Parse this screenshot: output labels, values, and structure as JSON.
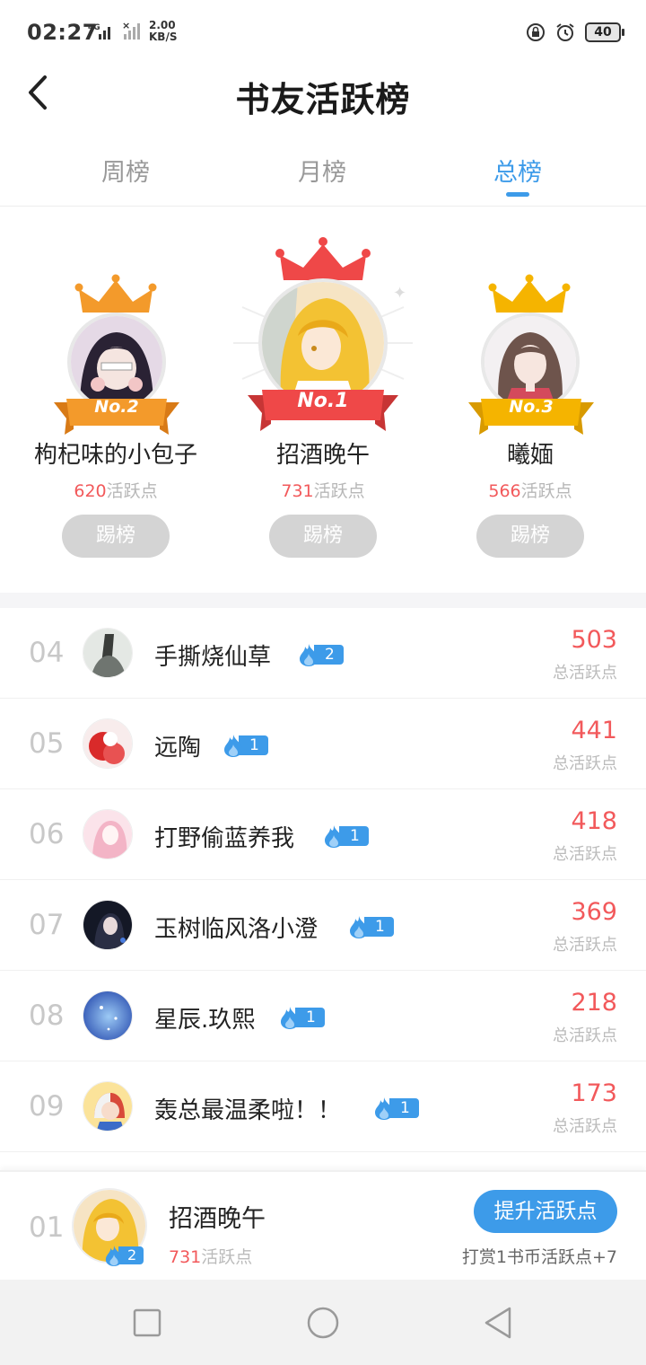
{
  "status_bar": {
    "time": "02:27",
    "network": "4G",
    "speed_value": "2.00",
    "speed_unit": "KB/S",
    "battery": "40"
  },
  "header": {
    "title": "书友活跃榜"
  },
  "tabs": [
    {
      "label": "周榜",
      "active": false
    },
    {
      "label": "月榜",
      "active": false
    },
    {
      "label": "总榜",
      "active": true
    }
  ],
  "podium": {
    "first": {
      "badge": "No.1",
      "name": "招酒晚午",
      "points": "731",
      "points_suffix": "活跃点",
      "button": "踢榜"
    },
    "second": {
      "badge": "No.2",
      "name": "枸杞味的小包子",
      "points": "620",
      "points_suffix": "活跃点",
      "button": "踢榜"
    },
    "third": {
      "badge": "No.3",
      "name": "曦媔",
      "points": "566",
      "points_suffix": "活跃点",
      "button": "踢榜"
    }
  },
  "ranking": [
    {
      "rank": "04",
      "name": "手撕烧仙草",
      "level": "2",
      "score": "503",
      "score_label": "总活跃点"
    },
    {
      "rank": "05",
      "name": "远陶",
      "level": "1",
      "score": "441",
      "score_label": "总活跃点"
    },
    {
      "rank": "06",
      "name": "打野偷蓝养我",
      "level": "1",
      "score": "418",
      "score_label": "总活跃点"
    },
    {
      "rank": "07",
      "name": "玉树临风洛小澄",
      "level": "1",
      "score": "369",
      "score_label": "总活跃点"
    },
    {
      "rank": "08",
      "name": "星辰.玖熙",
      "level": "1",
      "score": "218",
      "score_label": "总活跃点"
    },
    {
      "rank": "09",
      "name": "轰总最温柔啦！！",
      "level": "1",
      "score": "173",
      "score_label": "总活跃点"
    }
  ],
  "my_rank": {
    "rank": "01",
    "name": "招酒晚午",
    "level": "2",
    "points": "731",
    "points_suffix": "活跃点",
    "boost_button": "提升活跃点",
    "reward_hint": "打赏1书币活跃点+7"
  },
  "colors": {
    "accent": "#3d9be9",
    "score_red": "#f2595b",
    "gold_crown": "#f5b400",
    "orange_crown": "#f39a2b",
    "red_crown": "#ef4848"
  },
  "icons": [
    "back-icon",
    "flame-icon",
    "crown-icon",
    "lock-rotation-icon",
    "alarm-icon",
    "battery-icon",
    "nav-recent-icon",
    "nav-home-icon",
    "nav-back-icon"
  ]
}
